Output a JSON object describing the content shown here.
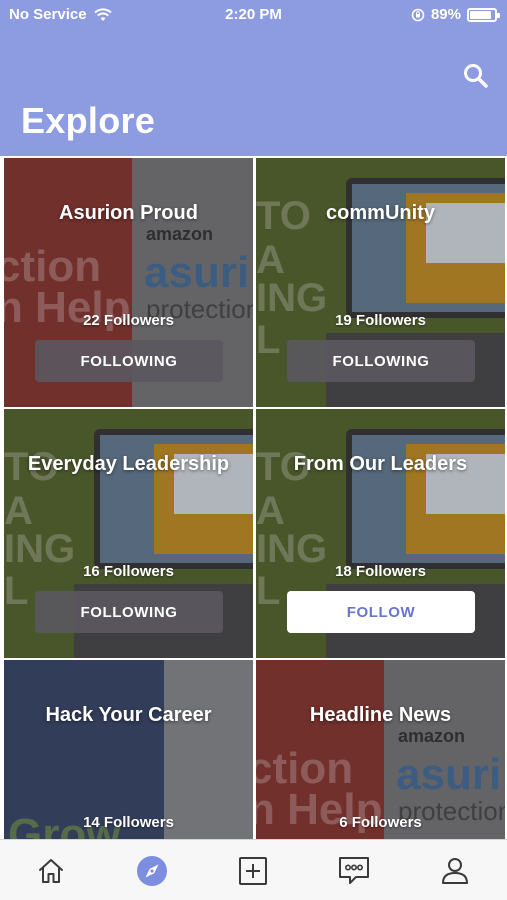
{
  "status_bar": {
    "carrier": "No Service",
    "time": "2:20 PM",
    "battery": "89%",
    "battery_level": 0.89
  },
  "header": {
    "title": "Explore",
    "search_icon": "search-icon"
  },
  "channels": [
    {
      "name": "Asurion Proud",
      "followers": "22 Followers",
      "button": "FOLLOWING",
      "following": true,
      "image": "asurion-banner"
    },
    {
      "name": "commUnity",
      "followers": "19 Followers",
      "button": "FOLLOWING",
      "following": true,
      "image": "laptop-envelope"
    },
    {
      "name": "Everyday Leadership",
      "followers": "16 Followers",
      "button": "FOLLOWING",
      "following": true,
      "image": "laptop-envelope"
    },
    {
      "name": "From Our Leaders",
      "followers": "18 Followers",
      "button": "FOLLOW",
      "following": false,
      "image": "laptop-envelope"
    },
    {
      "name": "Hack Your Career",
      "followers": "14 Followers",
      "button": "",
      "following": null,
      "image": "career-photo"
    },
    {
      "name": "Headline News",
      "followers": "6 Followers",
      "button": "",
      "following": null,
      "image": "asurion-banner"
    }
  ],
  "tab_bar": {
    "tabs": [
      {
        "icon": "home-icon",
        "active": false
      },
      {
        "icon": "compass-icon",
        "active": true
      },
      {
        "icon": "add-post-icon",
        "active": false
      },
      {
        "icon": "messages-icon",
        "active": false
      },
      {
        "icon": "profile-icon",
        "active": false
      }
    ],
    "active_color": "#7d8de0",
    "icon_color": "#3a3a3c"
  },
  "colors": {
    "header_bg": "#8d9ce0",
    "follow_text": "#6677cc"
  }
}
